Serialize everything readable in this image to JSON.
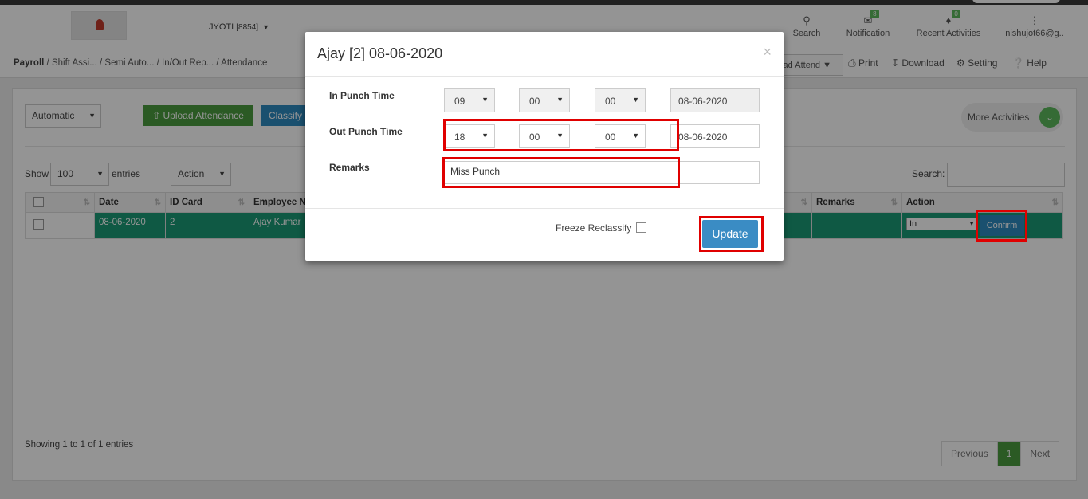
{
  "header": {
    "company": "JYOTI",
    "company_code": "[8854]",
    "search_label": "Search",
    "notification_label": "Notification",
    "notification_count": "8",
    "activities_label": "Recent Activities",
    "activities_count": "0",
    "user": "nishujot66@g.."
  },
  "breadcrumb": {
    "root": "Payroll",
    "path": " / Shift Assi... / Semi Auto... / In/Out Rep... / Attendance"
  },
  "toolbar": {
    "upload_select": "load Attend",
    "print": "Print",
    "download": "Download",
    "setting": "Setting",
    "help": "Help"
  },
  "filters": {
    "mode": "Automatic",
    "upload_button": "Upload Attendance",
    "classify_button": "Classify",
    "more_activities": "More Activities",
    "show_label": "Show",
    "entries_value": "100",
    "entries_label": "entries",
    "action_select": "Action",
    "search_label": "Search:"
  },
  "table": {
    "columns": [
      "Date",
      "ID Card",
      "Employee Na",
      "Remarks",
      "Action"
    ],
    "rows": [
      {
        "date": "08-06-2020",
        "id_card": "2",
        "employee": "Ajay Kumar",
        "remarks": "",
        "action": "In",
        "confirm": "Confirm"
      }
    ]
  },
  "footer": {
    "showing": "Showing 1 to 1 of 1 entries",
    "previous": "Previous",
    "page": "1",
    "next": "Next"
  },
  "modal": {
    "title": "Ajay [2] 08-06-2020",
    "close": "×",
    "in_label": "In Punch Time",
    "in_hour": "09",
    "in_min": "00",
    "in_sec": "00",
    "in_date": "08-06-2020",
    "out_label": "Out Punch Time",
    "out_hour": "18",
    "out_min": "00",
    "out_sec": "00",
    "out_date": "08-06-2020",
    "remarks_label": "Remarks",
    "remarks_value": "Miss Punch",
    "freeze_label": "Freeze Reclassify",
    "update_button": "Update"
  },
  "colors": {
    "highlight": "#e00000",
    "row_selected": "#1a9a76",
    "primary": "#3a8cc4",
    "success": "#4a9c3e"
  },
  "icons": [
    "search-icon",
    "envelope-icon",
    "bell-icon",
    "dots-icon",
    "print-icon",
    "download-icon",
    "gear-icon",
    "help-icon",
    "upload-icon",
    "chevron-down-icon",
    "sort-icon"
  ]
}
